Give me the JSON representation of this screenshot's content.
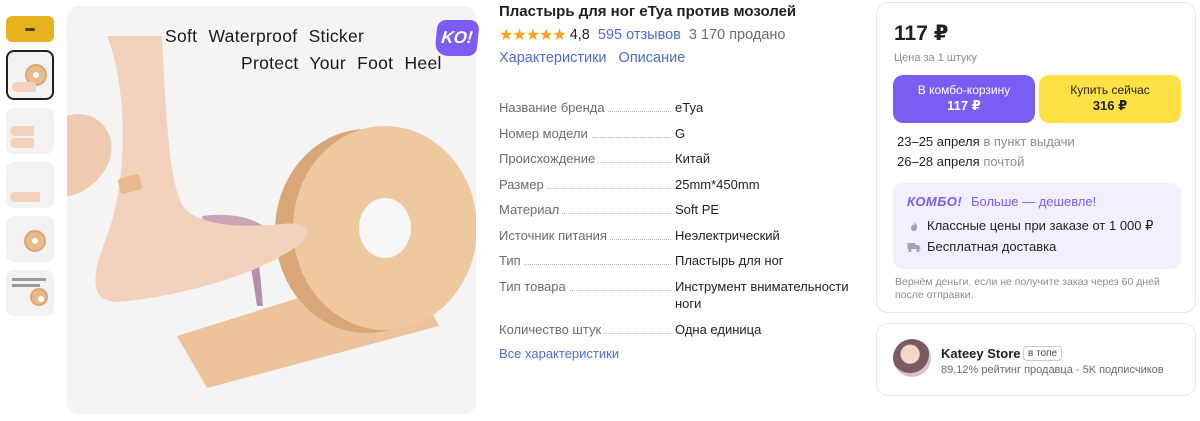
{
  "gallery": {
    "main_image_text_line1": "Soft Waterproof Sticker",
    "main_image_text_line2": "Protect Your Foot Heel",
    "badge": "KO!"
  },
  "product": {
    "title": "Пластырь для ног eTya против мозолей",
    "stars": "★★★★★",
    "rating": "4,8",
    "reviews": "595 отзывов",
    "sold": "3 170 продано",
    "tabs": [
      "Характеристики",
      "Описание"
    ]
  },
  "specs": [
    {
      "key": "Название бренда",
      "value": "eTya"
    },
    {
      "key": "Номер модели",
      "value": "G"
    },
    {
      "key": "Происхождение",
      "value": "Китай"
    },
    {
      "key": "Размер",
      "value": "25mm*450mm"
    },
    {
      "key": "Материал",
      "value": "Soft PE"
    },
    {
      "key": "Источник питания",
      "value": "Неэлектрический"
    },
    {
      "key": "Тип",
      "value": "Пластырь для ног"
    },
    {
      "key": "Тип товара",
      "value": "Инструмент внимательности ноги"
    },
    {
      "key": "Количество штук",
      "value": "Одна единица"
    }
  ],
  "all_specs_link": "Все характеристики",
  "price_card": {
    "price": "117 ₽",
    "unit_price": "Цена за 1 штуку",
    "combo_button_label": "В комбо-корзину",
    "combo_button_price": "117 ₽",
    "buy_button_label": "Купить сейчас",
    "buy_button_price": "316 ₽",
    "delivery1_date": "23–25 апреля",
    "delivery1_method": "в пункт выдачи",
    "delivery2_date": "26–28 апреля",
    "delivery2_method": "почтой",
    "combo_tag": "КОМБО!",
    "combo_sub": "Больше — дешевле!",
    "perk1": "Классные цены при заказе от 1 000 ₽",
    "perk2": "Бесплатная доставка",
    "refund": "Вернём деньги, если не получите заказ через 60 дней после отправки."
  },
  "seller": {
    "name": "Kateey Store",
    "badge": "в топе",
    "stats": "89,12% рейтинг продавца  ·  5K подписчиков"
  },
  "colors": {
    "accent_purple": "#7a5ef3",
    "buy_yellow": "#ffe145",
    "link_blue": "#4f6bd6",
    "star_orange": "#ff9f1c"
  }
}
